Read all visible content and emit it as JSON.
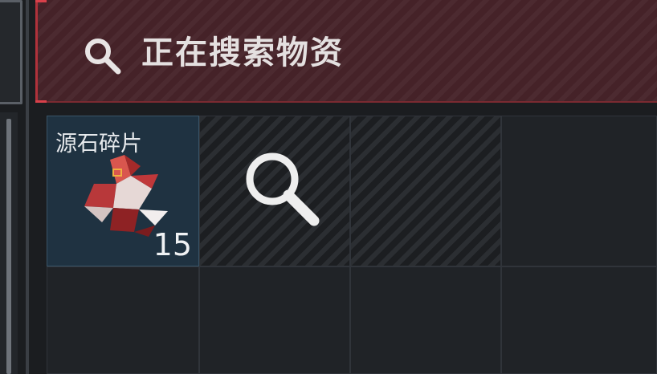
{
  "search_banner": {
    "label": "正在搜索物资",
    "icon": "search-icon",
    "accent_color": "#b0323b"
  },
  "inventory": {
    "slots": [
      {
        "item_name": "源石碎片",
        "count": "15",
        "icon": "crystal-fragment-icon",
        "state": "filled"
      },
      {
        "state": "searching",
        "icon": "search-icon"
      },
      {
        "state": "searching"
      },
      {
        "state": "empty"
      },
      {
        "state": "empty"
      },
      {
        "state": "empty"
      },
      {
        "state": "empty"
      },
      {
        "state": "empty"
      }
    ]
  }
}
